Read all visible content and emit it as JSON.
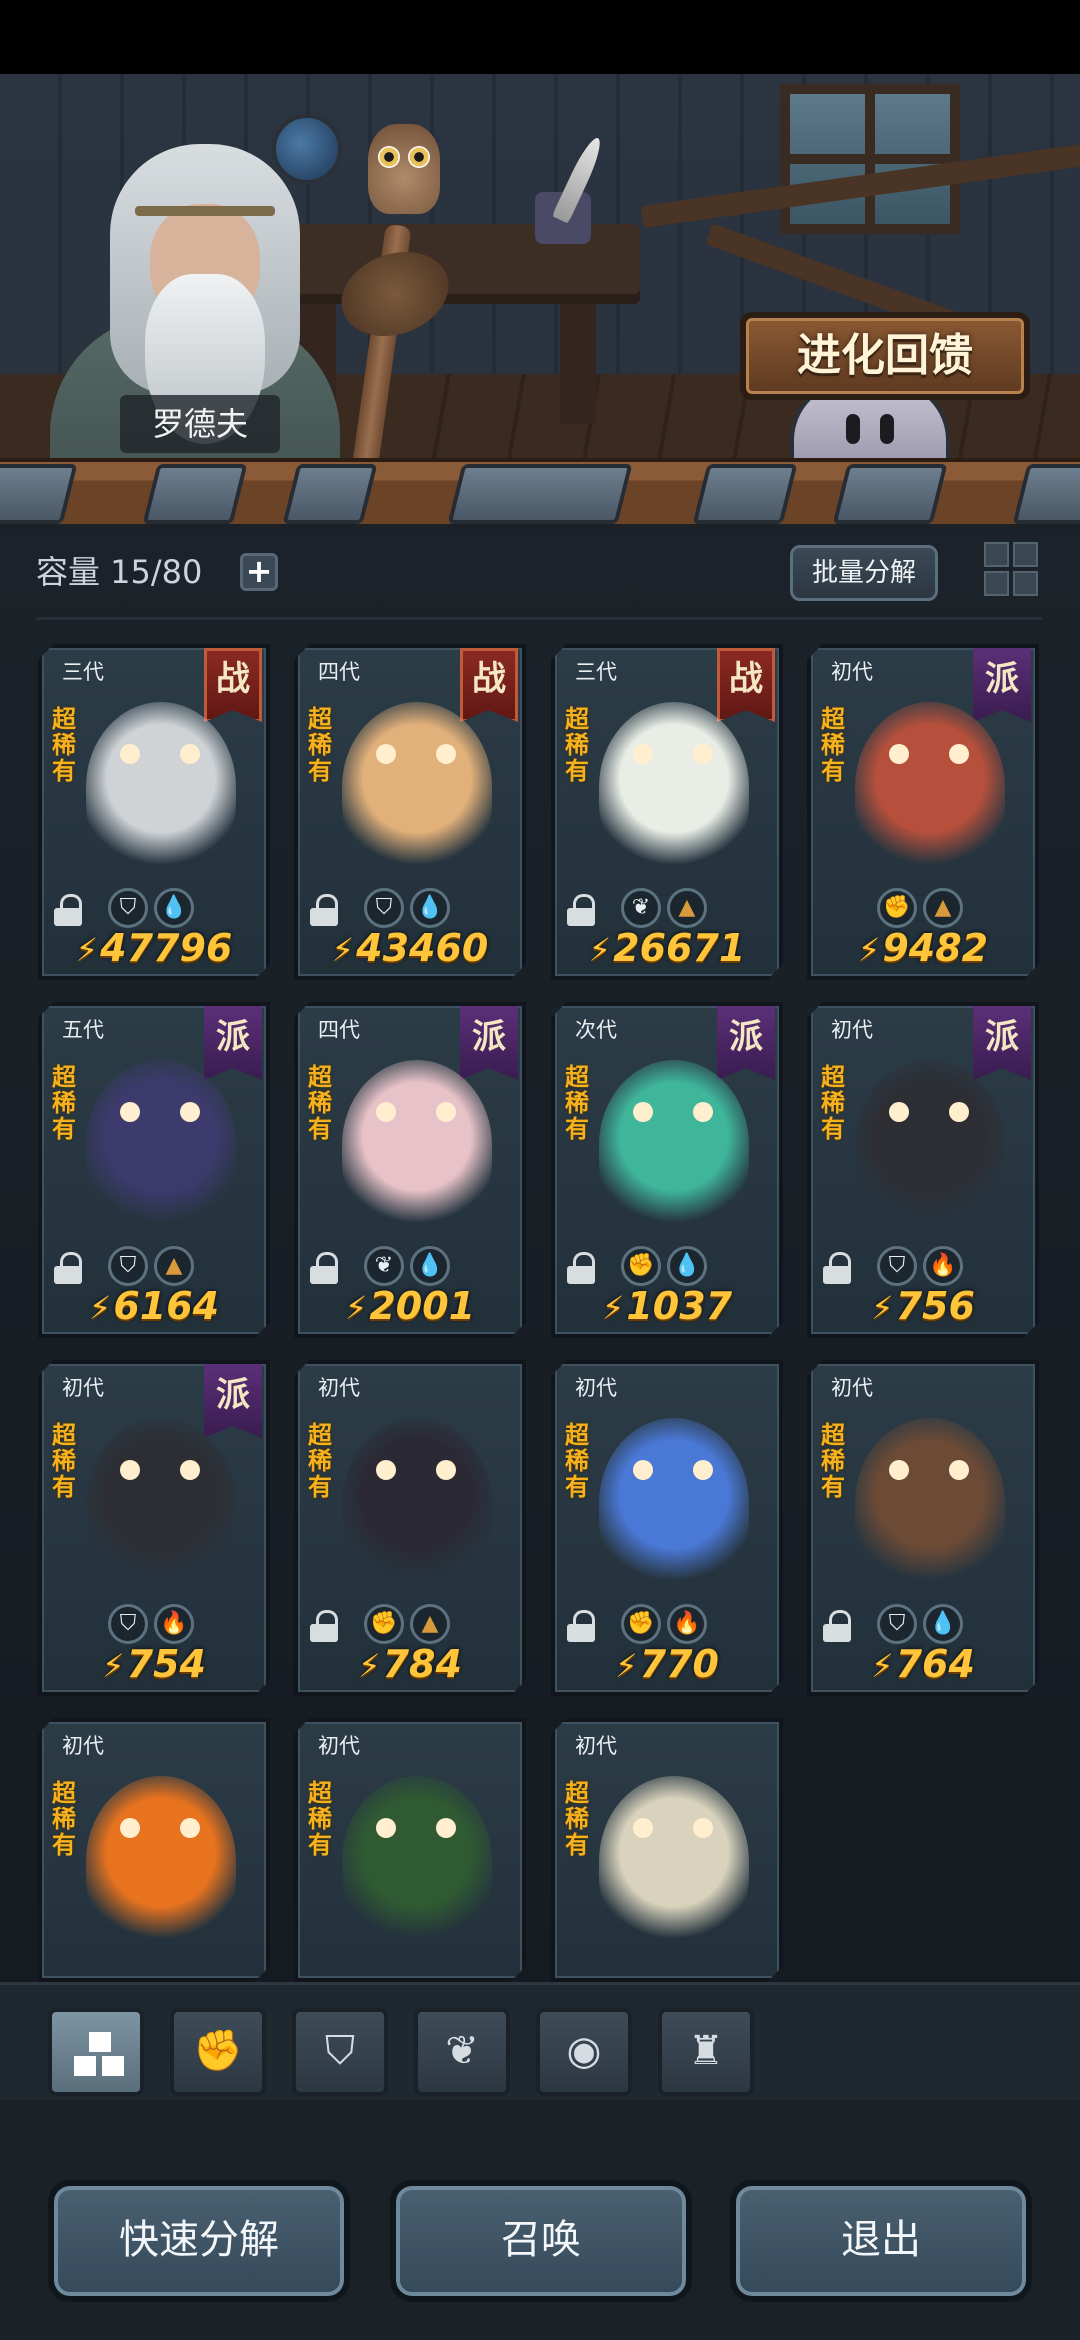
{
  "header": {
    "npc_name": "罗德夫",
    "evolve_button": "进化回馈"
  },
  "toolbar": {
    "capacity": "容量 15/80",
    "add_capacity": "+",
    "bulk_decompose": "批量分解",
    "grid_toggle_icon": "grid-icon"
  },
  "cards": [
    {
      "generation": "三代",
      "rarity": "超稀有",
      "faction": "战",
      "faction_type": "war",
      "icons": [
        "shield-icon",
        "water-icon"
      ],
      "icon_glyphs": [
        "⛉",
        "💧"
      ],
      "power": "47796",
      "locked": true,
      "art_color": "#cfd3d6"
    },
    {
      "generation": "四代",
      "rarity": "超稀有",
      "faction": "战",
      "faction_type": "war",
      "icons": [
        "shield-icon",
        "water-icon"
      ],
      "icon_glyphs": [
        "⛉",
        "💧"
      ],
      "power": "43460",
      "locked": true,
      "art_color": "#e2b07a"
    },
    {
      "generation": "三代",
      "rarity": "超稀有",
      "faction": "战",
      "faction_type": "war",
      "icons": [
        "leaf-icon",
        "earth-icon"
      ],
      "icon_glyphs": [
        "❦",
        "▲"
      ],
      "power": "26671",
      "locked": true,
      "art_color": "#e9ede6"
    },
    {
      "generation": "初代",
      "rarity": "超稀有",
      "faction": "派",
      "faction_type": "sect",
      "icons": [
        "fist-icon",
        "earth-icon"
      ],
      "icon_glyphs": [
        "✊",
        "▲"
      ],
      "power": "9482",
      "locked": false,
      "art_color": "#b6503c"
    },
    {
      "generation": "五代",
      "rarity": "超稀有",
      "faction": "派",
      "faction_type": "sect",
      "icons": [
        "shield-icon",
        "earth-icon"
      ],
      "icon_glyphs": [
        "⛉",
        "▲"
      ],
      "power": "6164",
      "locked": true,
      "art_color": "#3d3a6e"
    },
    {
      "generation": "四代",
      "rarity": "超稀有",
      "faction": "派",
      "faction_type": "sect",
      "icons": [
        "leaf-icon",
        "water-icon"
      ],
      "icon_glyphs": [
        "❦",
        "💧"
      ],
      "power": "2001",
      "locked": true,
      "art_color": "#e7c2c8"
    },
    {
      "generation": "次代",
      "rarity": "超稀有",
      "faction": "派",
      "faction_type": "sect",
      "icons": [
        "fist-icon",
        "water-icon"
      ],
      "icon_glyphs": [
        "✊",
        "💧"
      ],
      "power": "1037",
      "locked": true,
      "art_color": "#3fb59a"
    },
    {
      "generation": "初代",
      "rarity": "超稀有",
      "faction": "派",
      "faction_type": "sect",
      "icons": [
        "shield-icon",
        "fire-icon"
      ],
      "icon_glyphs": [
        "⛉",
        "🔥"
      ],
      "power": "756",
      "locked": true,
      "art_color": "#2d2e34"
    },
    {
      "generation": "初代",
      "rarity": "超稀有",
      "faction": "派",
      "faction_type": "sect",
      "icons": [
        "shield-icon",
        "fire-icon"
      ],
      "icon_glyphs": [
        "⛉",
        "🔥"
      ],
      "power": "754",
      "locked": false,
      "art_color": "#2d2e34"
    },
    {
      "generation": "初代",
      "rarity": "超稀有",
      "faction": "",
      "faction_type": "",
      "icons": [
        "fist-icon",
        "earth-icon"
      ],
      "icon_glyphs": [
        "✊",
        "▲"
      ],
      "power": "784",
      "locked": true,
      "art_color": "#2b2933"
    },
    {
      "generation": "初代",
      "rarity": "超稀有",
      "faction": "",
      "faction_type": "",
      "icons": [
        "fist-icon",
        "fire-icon"
      ],
      "icon_glyphs": [
        "✊",
        "🔥"
      ],
      "power": "770",
      "locked": true,
      "art_color": "#4a78d6"
    },
    {
      "generation": "初代",
      "rarity": "超稀有",
      "faction": "",
      "faction_type": "",
      "icons": [
        "shield-icon",
        "water-icon"
      ],
      "icon_glyphs": [
        "⛉",
        "💧"
      ],
      "power": "764",
      "locked": true,
      "art_color": "#6b4a36"
    },
    {
      "generation": "初代",
      "rarity": "超稀有",
      "faction": "",
      "faction_type": "",
      "icons": [],
      "icon_glyphs": [],
      "power": "",
      "locked": false,
      "art_color": "#e8731f"
    },
    {
      "generation": "初代",
      "rarity": "超稀有",
      "faction": "",
      "faction_type": "",
      "icons": [],
      "icon_glyphs": [],
      "power": "",
      "locked": false,
      "art_color": "#2f5a32"
    },
    {
      "generation": "初代",
      "rarity": "超稀有",
      "faction": "",
      "faction_type": "",
      "icons": [],
      "icon_glyphs": [],
      "power": "",
      "locked": false,
      "art_color": "#d9d3bd"
    }
  ],
  "filter_tabs": [
    {
      "icon": "all-blocks-icon",
      "glyph": "",
      "active": true
    },
    {
      "icon": "fist-icon",
      "glyph": "✊",
      "active": false
    },
    {
      "icon": "shield-icon",
      "glyph": "⛉",
      "active": false
    },
    {
      "icon": "leaf-icon",
      "glyph": "❦",
      "active": false
    },
    {
      "icon": "spirit-icon",
      "glyph": "◉",
      "active": false
    },
    {
      "icon": "tower-icon",
      "glyph": "♜",
      "active": false
    }
  ],
  "buttons": {
    "quick_decompose": "快速分解",
    "summon": "召唤",
    "exit": "退出"
  }
}
